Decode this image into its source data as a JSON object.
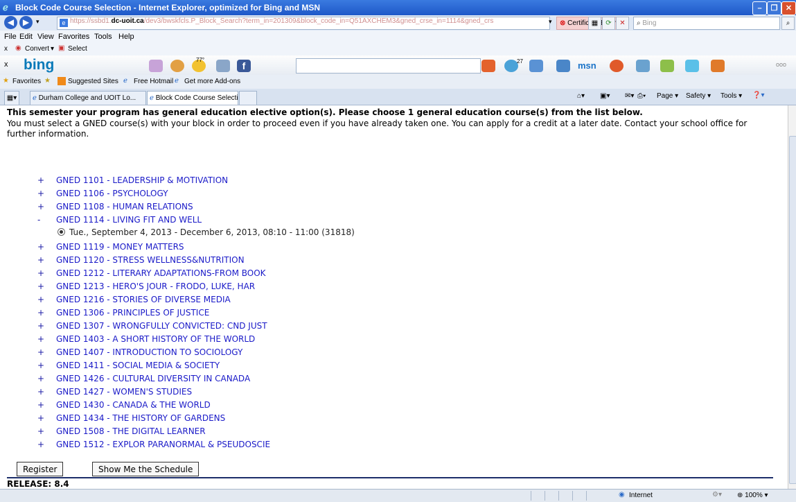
{
  "window": {
    "title": "Block Code Course Selection - Internet Explorer, optimized for Bing and MSN"
  },
  "address": {
    "url_pre": "https://ssbd1.",
    "url_domain": "dc-uoit.ca",
    "url_post": "/dev3/bwskfcls.P_Block_Search?term_in=201309&block_code_in=Q51AXCHEM3&gned_crse_in=1114&gned_crs",
    "cert_label": "Certificate Error",
    "search_placeholder": "Bing"
  },
  "menu": [
    "File",
    "Edit",
    "View",
    "Favorites",
    "Tools",
    "Help"
  ],
  "convert": {
    "convert_label": "Convert",
    "select_label": "Select"
  },
  "bing": {
    "logo": "bing",
    "temp": "77°",
    "badge": "27"
  },
  "favorites": {
    "label": "Favorites",
    "suggested": "Suggested Sites",
    "hotmail": "Free Hotmail",
    "addons": "Get more Add-ons"
  },
  "tabs": [
    {
      "label": "Durham College and UOIT Lo..."
    },
    {
      "label": "Block Code Course Selection"
    }
  ],
  "command": {
    "page": "Page",
    "safety": "Safety",
    "tools": "Tools"
  },
  "page": {
    "notice": "This semester your program has general education elective option(s). Please choose 1 general education course(s) from the list below.",
    "description": "You must select a GNED course(s) with your block in order to proceed even if you have already taken one. You can apply for a credit at a later date. Contact your school office for further information.",
    "courses": [
      {
        "sign": "+",
        "name": "GNED 1101 - LEADERSHIP & MOTIVATION"
      },
      {
        "sign": "+",
        "name": "GNED 1106 - PSYCHOLOGY"
      },
      {
        "sign": "+",
        "name": "GNED 1108 - HUMAN RELATIONS"
      },
      {
        "sign": "-",
        "name": "GNED 1114 - LIVING FIT AND WELL"
      },
      {
        "sign": "+",
        "name": "GNED 1119 - MONEY MATTERS"
      },
      {
        "sign": "+",
        "name": "GNED 1120 - STRESS WELLNESS&NUTRITION"
      },
      {
        "sign": "+",
        "name": "GNED 1212 - LITERARY ADAPTATIONS-FROM BOOK"
      },
      {
        "sign": "+",
        "name": "GNED 1213 - HERO'S JOUR - FRODO, LUKE, HAR"
      },
      {
        "sign": "+",
        "name": "GNED 1216 - STORIES OF DIVERSE MEDIA"
      },
      {
        "sign": "+",
        "name": "GNED 1306 - PRINCIPLES OF JUSTICE"
      },
      {
        "sign": "+",
        "name": "GNED 1307 - WRONGFULLY CONVICTED: CND JUST"
      },
      {
        "sign": "+",
        "name": "GNED 1403 - A SHORT HISTORY OF THE WORLD"
      },
      {
        "sign": "+",
        "name": "GNED 1407 - INTRODUCTION TO SOCIOLOGY"
      },
      {
        "sign": "+",
        "name": "GNED 1411 - SOCIAL MEDIA & SOCIETY"
      },
      {
        "sign": "+",
        "name": "GNED 1426 - CULTURAL DIVERSITY IN CANADA"
      },
      {
        "sign": "+",
        "name": "GNED 1427 - WOMEN'S STUDIES"
      },
      {
        "sign": "+",
        "name": "GNED 1430 - CANADA & THE WORLD"
      },
      {
        "sign": "+",
        "name": "GNED 1434 - THE HISTORY OF GARDENS"
      },
      {
        "sign": "+",
        "name": "GNED 1508 - THE DIGITAL LEARNER"
      },
      {
        "sign": "+",
        "name": "GNED 1512 - EXPLOR PARANORMAL & PSEUDOSCIE"
      }
    ],
    "option": "Tue., September 4, 2013 - December 6, 2013, 08:10 - 11:00 (31818)",
    "register_label": "Register",
    "schedule_label": "Show Me the Schedule",
    "release": "RELEASE: 8.4"
  },
  "status": {
    "zone": "Internet",
    "zoom": "100%"
  }
}
